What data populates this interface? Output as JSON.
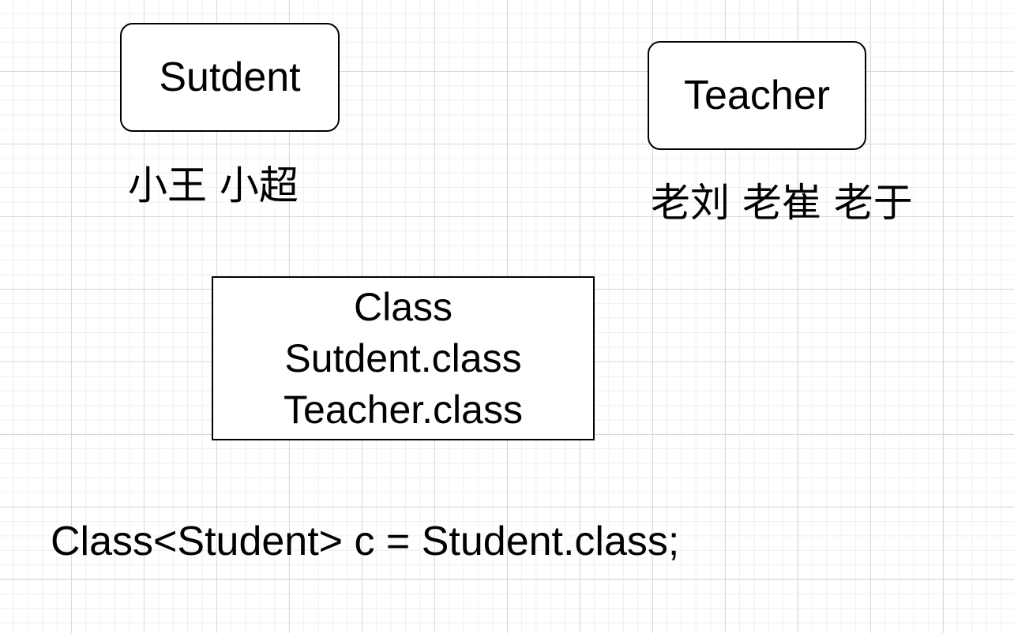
{
  "diagram": {
    "student_box": {
      "label": "Sutdent",
      "instances": "小王 小超"
    },
    "teacher_box": {
      "label": "Teacher",
      "instances": "老刘 老崔 老于"
    },
    "class_box": {
      "lines": [
        "Class",
        "Sutdent.class",
        "Teacher.class"
      ]
    },
    "code_line": "Class<Student> c = Student.class;"
  }
}
